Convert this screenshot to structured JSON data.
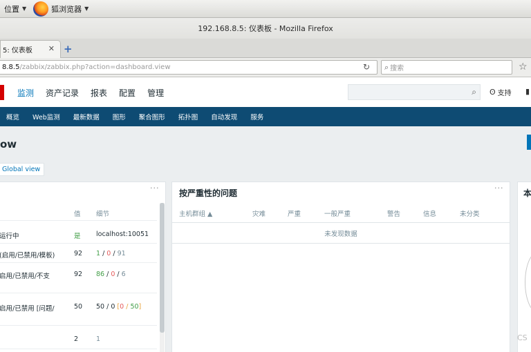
{
  "gnome": {
    "places_label": "位置",
    "browser_label": "狐浏览器"
  },
  "window": {
    "title": "192.168.8.5: 仪表板 - Mozilla Firefox"
  },
  "tab": {
    "label": "5: 仪表板"
  },
  "nav": {
    "url_host": "8.8.5",
    "url_path": "/zabbix/zabbix.php?action=dashboard.view",
    "search_placeholder": "搜索"
  },
  "zabbix": {
    "main_menu": [
      "监测",
      "资产记录",
      "报表",
      "配置",
      "管理"
    ],
    "support_label": "支持",
    "submenu": [
      "概览",
      "Web监测",
      "最新数据",
      "图形",
      "聚合图形",
      "拓扑图",
      "自动发现",
      "服务"
    ],
    "page_title": "ow",
    "breadcrumb": "Global view"
  },
  "sysinfo": {
    "col_value": "值",
    "col_details": "细节",
    "rows": [
      {
        "param": "运行中",
        "value": "是",
        "details": "localhost:10051"
      },
      {
        "param": "(启用/已禁用/模板)",
        "value": "92",
        "d1": "1",
        "d2": "0",
        "d3": "91"
      },
      {
        "param": "启用/已禁用/不支",
        "value": "92",
        "d1": "86",
        "d2": "0",
        "d3": "6"
      },
      {
        "param": "启用/已禁用 [问题/",
        "value": "50",
        "d1": "50",
        "d2": "0",
        "d3": "0",
        "d4": "50"
      },
      {
        "param": "",
        "value": "2",
        "d1": "1"
      }
    ]
  },
  "problems": {
    "title": "按严重性的问题",
    "headers": [
      "主机群组 ▲",
      "灾难",
      "严重",
      "一般严重",
      "警告",
      "信息",
      "未分类"
    ],
    "empty_text": "未发现数据"
  },
  "third_widget": {
    "title": "本"
  },
  "watermark": "CS",
  "colors": {
    "submenu_bg": "#0e4b73",
    "active_menu": "#0275b8",
    "logo_red": "#d40000",
    "ok_green": "#429e47"
  }
}
